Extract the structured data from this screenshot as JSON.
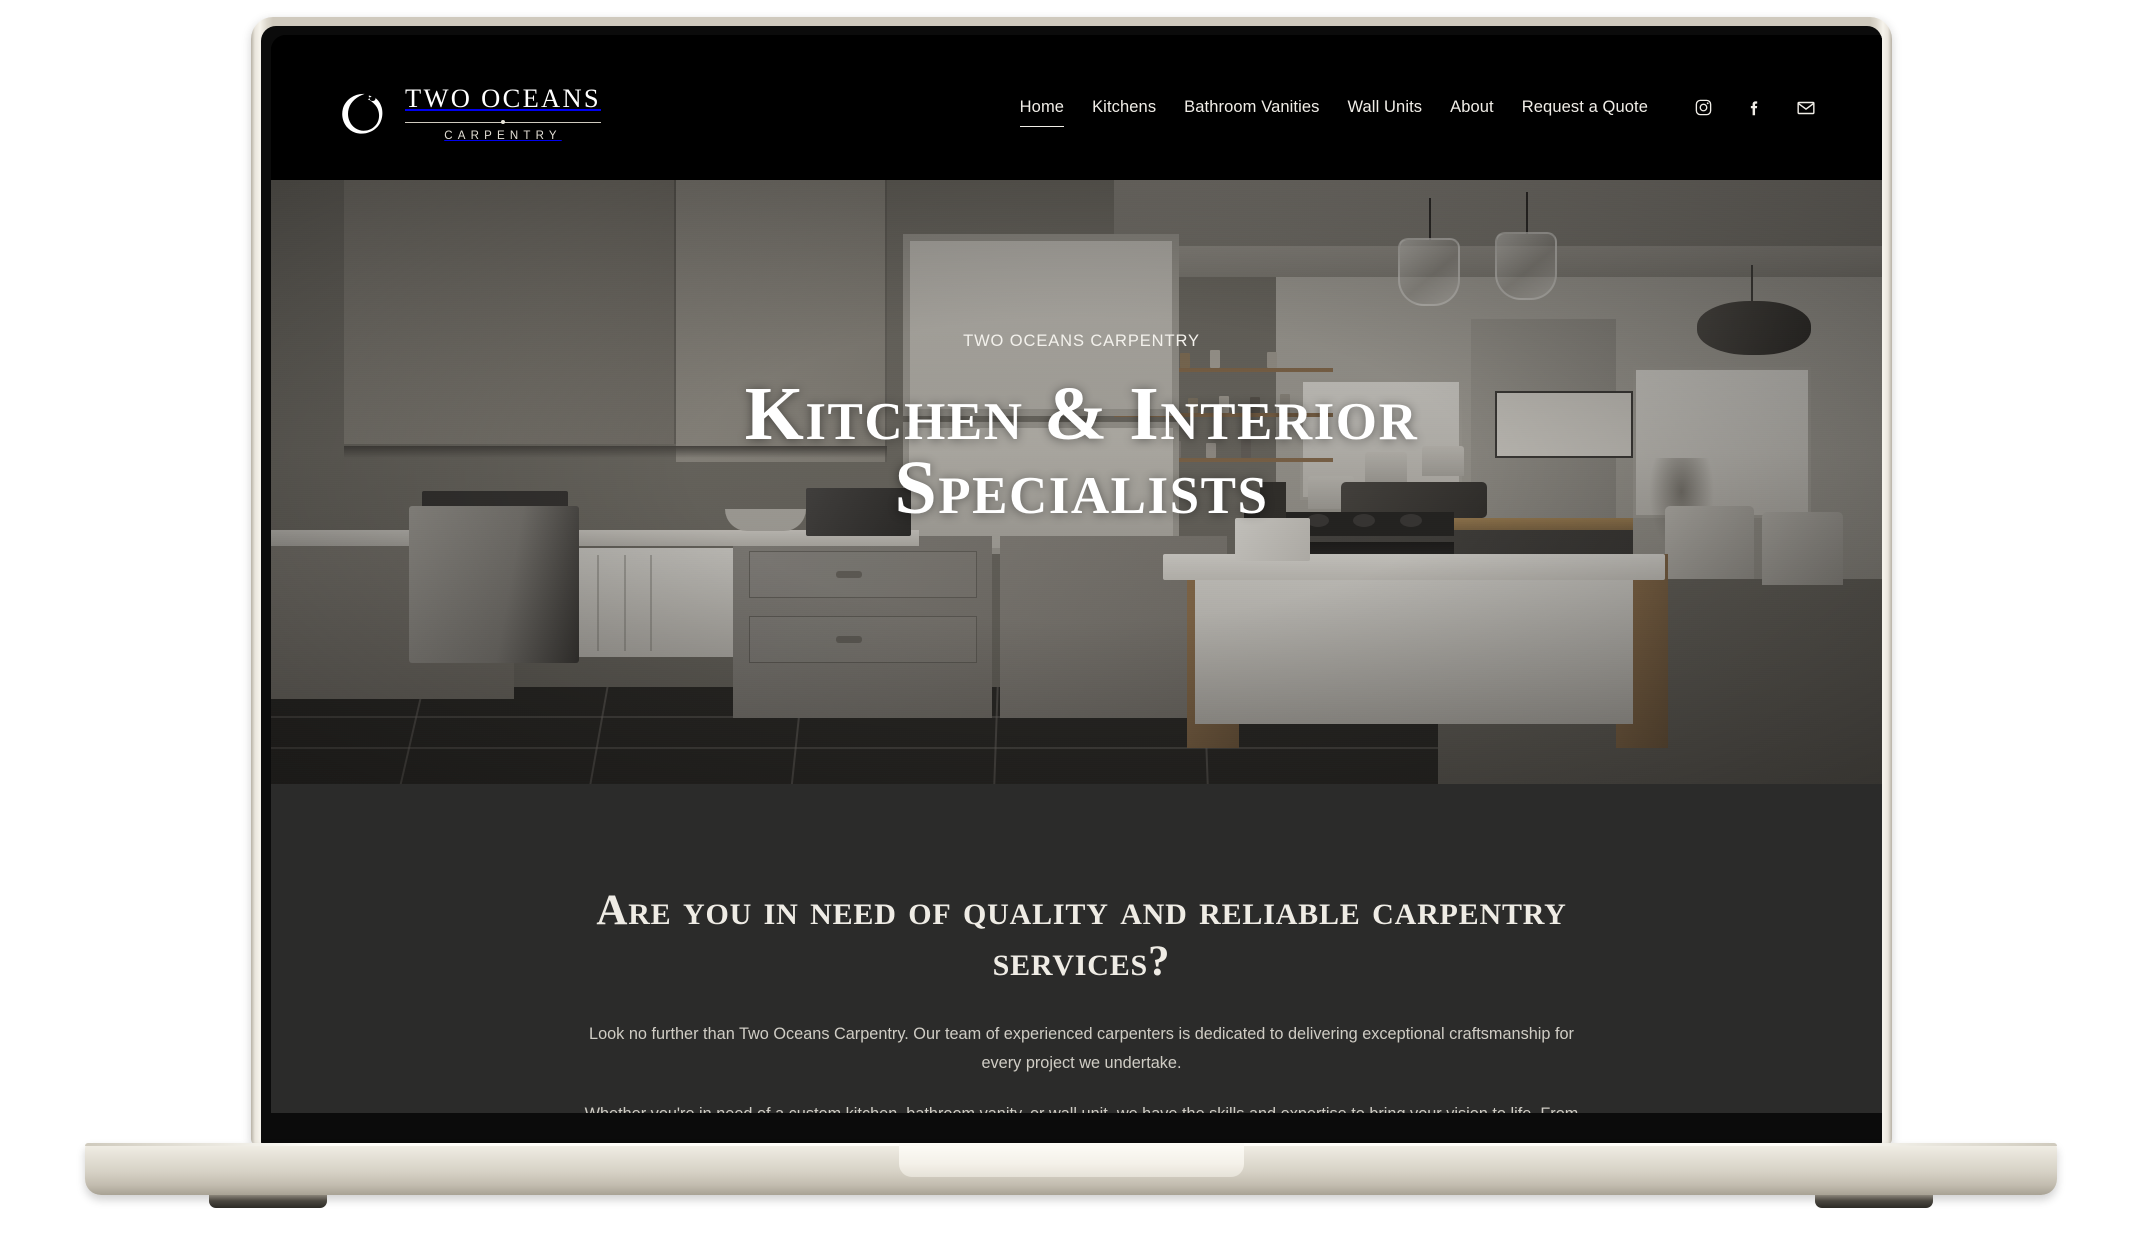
{
  "brand": {
    "name": "TWO OCEANS",
    "subtitle": "CARPENTRY",
    "mark_icon": "brush-circle-logo-icon"
  },
  "nav": {
    "items": [
      {
        "label": "Home",
        "active": true
      },
      {
        "label": "Kitchens",
        "active": false
      },
      {
        "label": "Bathroom Vanities",
        "active": false
      },
      {
        "label": "Wall Units",
        "active": false
      },
      {
        "label": "About",
        "active": false
      },
      {
        "label": "Request a Quote",
        "active": false
      }
    ],
    "socials": [
      {
        "name": "instagram-icon"
      },
      {
        "name": "facebook-icon"
      },
      {
        "name": "email-icon"
      }
    ]
  },
  "hero": {
    "eyebrow": "TWO OCEANS CARPENTRY",
    "title": "Kitchen & Interior Specialists",
    "image_alt": "Modern grey shaker kitchen with wooden island, pendant lights and slate floor"
  },
  "intro": {
    "heading": "Are you in need of quality and reliable carpentry services?",
    "paragraphs": [
      "Look no further than Two Oceans Carpentry. Our team of experienced carpenters is dedicated to delivering exceptional craftsmanship for every project we undertake.",
      "Whether you're in need of a custom kitchen, bathroom vanity, or wall unit, we have the skills and expertise to bring your vision to life. From"
    ]
  },
  "colors": {
    "header_bg": "#000000",
    "intro_bg": "#2b2b2a",
    "text_light": "#efece5",
    "body_text": "#cfccc4",
    "laptop_body": "#e5e1d7"
  }
}
